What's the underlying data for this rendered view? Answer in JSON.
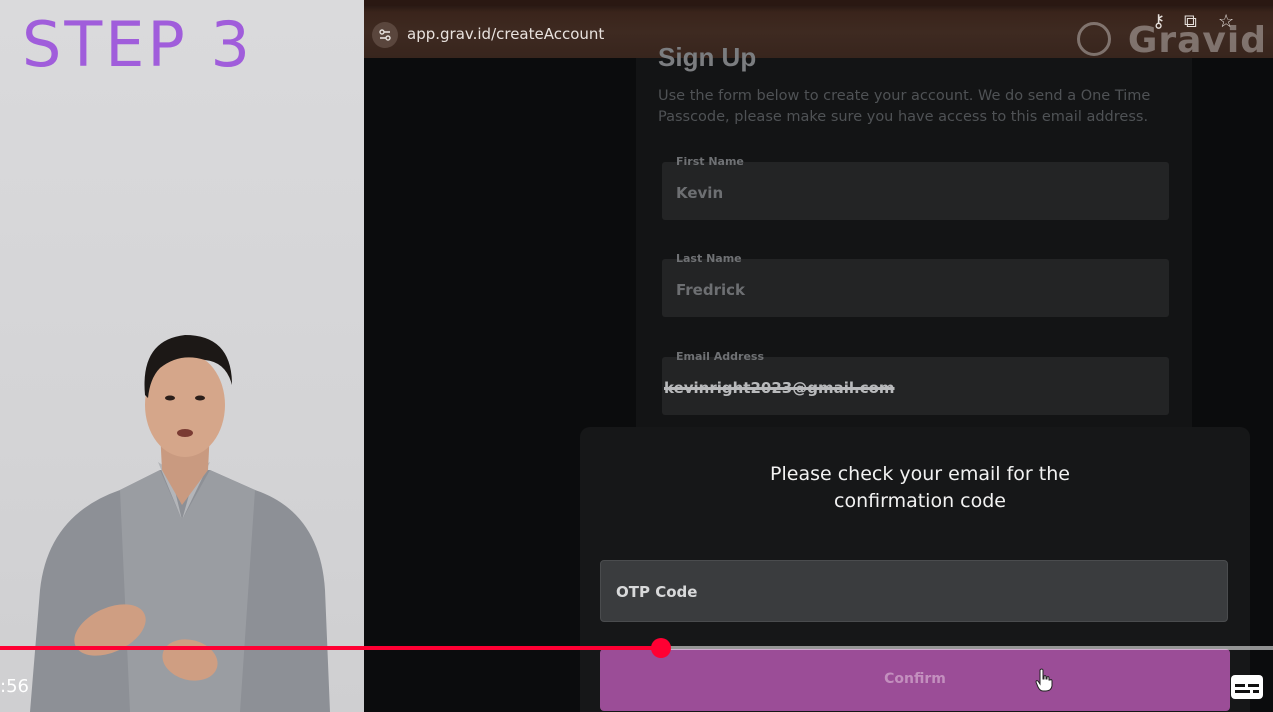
{
  "overlay": {
    "step_title": "STEP 3"
  },
  "browser": {
    "url_host": "app.grav.id",
    "url_path": "/createAccount",
    "watermark_text": "Gravid"
  },
  "form": {
    "heading": "Sign Up",
    "description": "Use the form below to create your account. We do send a One Time Passcode, please make sure you have access to this email address.",
    "fields": [
      {
        "label": "First Name",
        "value": "Kevin"
      },
      {
        "label": "Last Name",
        "value": "Fredrick"
      },
      {
        "label": "Email Address",
        "value": "kevinright2023@gmail.com"
      }
    ]
  },
  "otp_modal": {
    "message_line1": "Please check your email for the",
    "message_line2": "confirmation code",
    "otp_placeholder": "OTP Code",
    "confirm_label": "Confirm"
  },
  "player": {
    "time": ":56",
    "progress_fraction": 0.519
  },
  "colors": {
    "step_title": "#a05ddb",
    "progress": "#ff0033",
    "confirm_button": "#9b4d97",
    "browser_bar": "#3e2a21"
  },
  "icons": {
    "site_settings": "tune-icon",
    "password_key": "key-icon",
    "install_app": "install-icon",
    "bookmark": "star-icon",
    "cursor": "hand-cursor-icon",
    "captions": "subtitles-icon"
  }
}
